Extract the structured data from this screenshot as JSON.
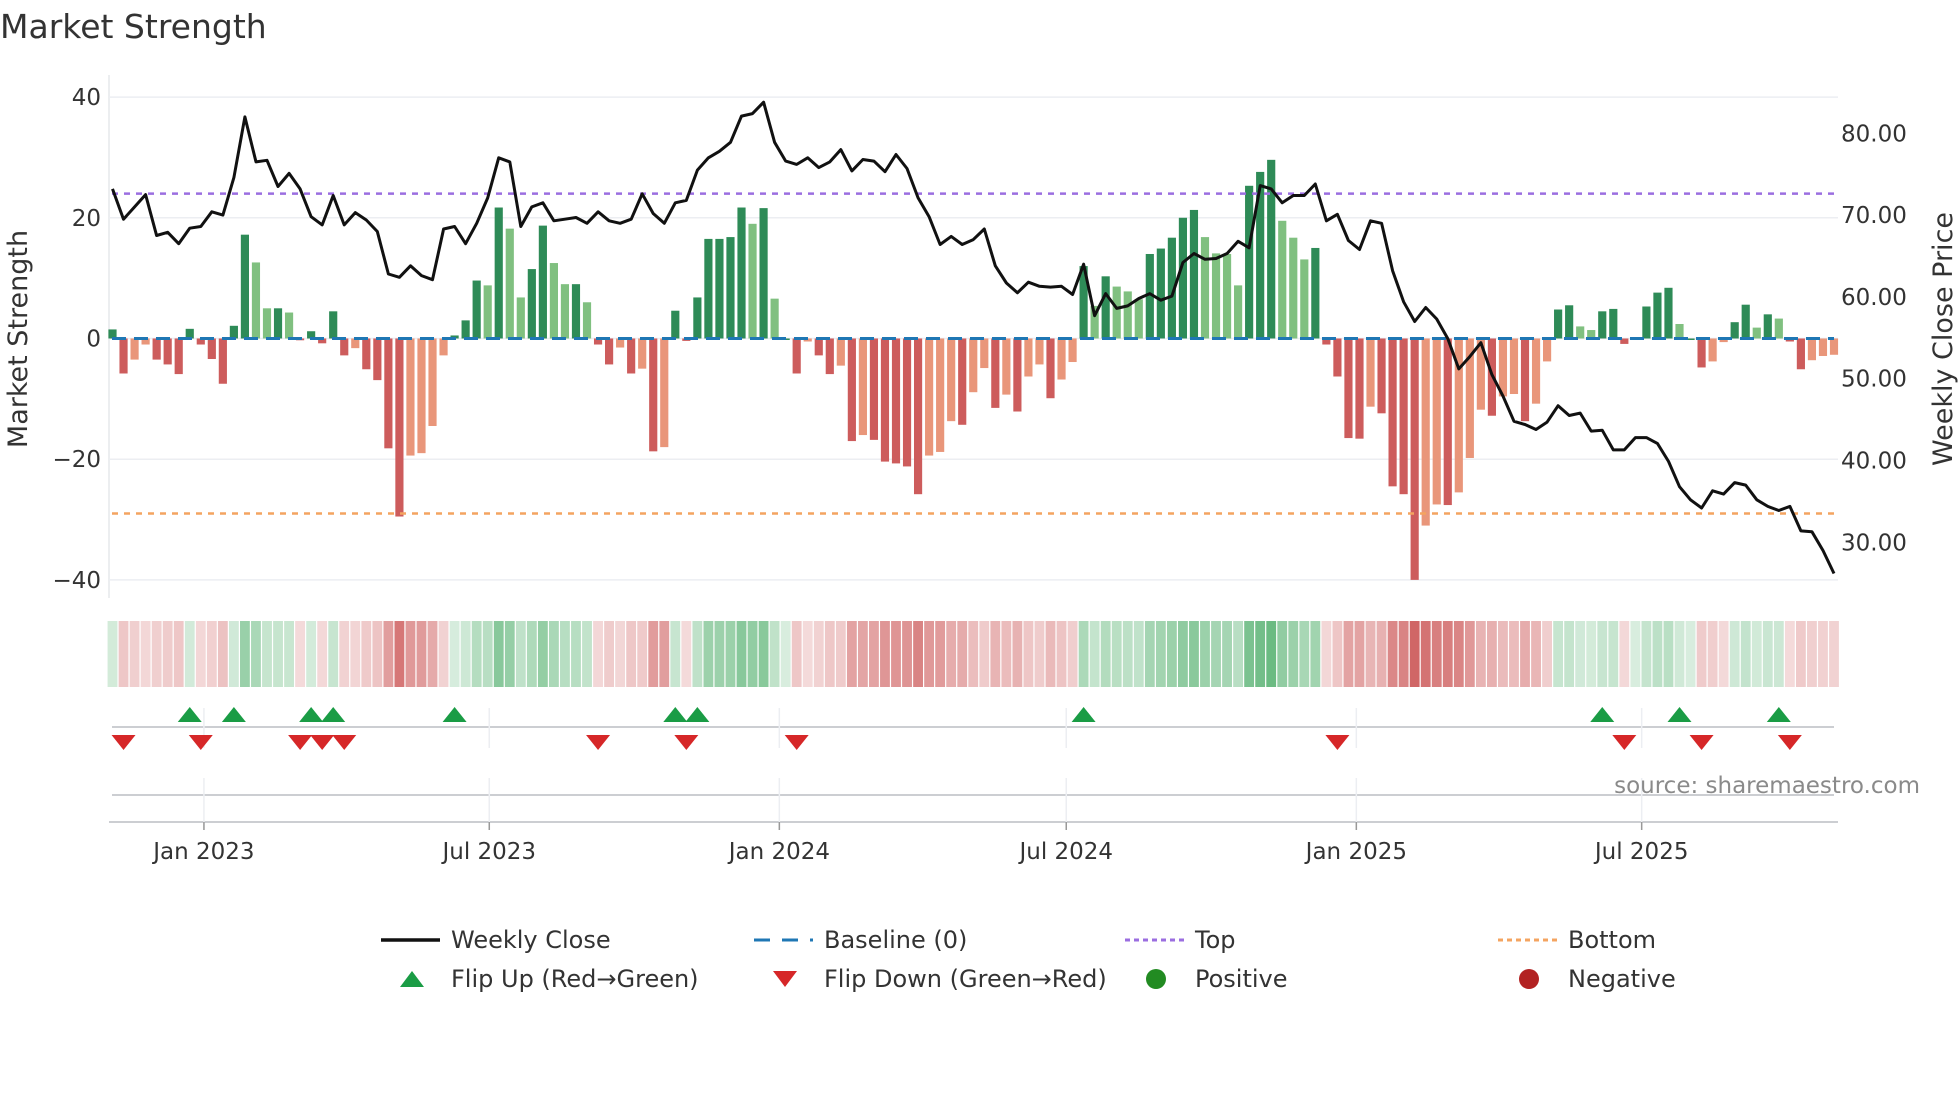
{
  "title": "Market Strength",
  "source": "source: sharemaestro.com",
  "chart_data": {
    "type": "bar+line",
    "left_axis": {
      "label": "Market Strength",
      "ylim": [
        -43,
        42
      ],
      "ticks": [
        -40,
        -20,
        0,
        20,
        40
      ],
      "tick_labels": [
        "−40",
        "−20",
        "0",
        "20",
        "40"
      ]
    },
    "right_axis": {
      "label": "Weekly Close Price",
      "ylim": [
        23.2,
        85.9
      ],
      "ticks": [
        30,
        40,
        50,
        60,
        70,
        80
      ],
      "tick_labels": [
        "30.00",
        "40.00",
        "50.00",
        "60.00",
        "70.00",
        "80.00"
      ]
    },
    "x_ticks": [
      {
        "date": "2023-01-01",
        "label": "Jan 2023"
      },
      {
        "date": "2023-07-01",
        "label": "Jul 2023"
      },
      {
        "date": "2024-01-01",
        "label": "Jan 2024"
      },
      {
        "date": "2024-07-01",
        "label": "Jul 2024"
      },
      {
        "date": "2025-01-01",
        "label": "Jan 2025"
      },
      {
        "date": "2025-07-01",
        "label": "Jul 2025"
      }
    ],
    "grid": true,
    "top_level": 24,
    "bottom_level": -29,
    "colors": {
      "close": "#111111",
      "baseline": "#1f77b4",
      "top": "#9b6ee0",
      "bottom": "#f4a460",
      "pos_strong": "#2e8b57",
      "pos_weak": "#80c080",
      "neg_strong": "#cd5c5c",
      "neg_weak": "#e9967a",
      "flip_up": "#1a9c45",
      "flip_down": "#d62728",
      "positive": "#228b22",
      "negative": "#b22222"
    },
    "dates": [
      "2022-11-04",
      "2022-11-11",
      "2022-11-18",
      "2022-11-25",
      "2022-12-02",
      "2022-12-09",
      "2022-12-16",
      "2022-12-23",
      "2022-12-30",
      "2023-01-06",
      "2023-01-13",
      "2023-01-20",
      "2023-01-27",
      "2023-02-03",
      "2023-02-10",
      "2023-02-17",
      "2023-02-24",
      "2023-03-03",
      "2023-03-10",
      "2023-03-17",
      "2023-03-24",
      "2023-03-31",
      "2023-04-07",
      "2023-04-14",
      "2023-04-21",
      "2023-04-28",
      "2023-05-05",
      "2023-05-12",
      "2023-05-19",
      "2023-05-26",
      "2023-06-02",
      "2023-06-09",
      "2023-06-16",
      "2023-06-23",
      "2023-06-30",
      "2023-07-07",
      "2023-07-14",
      "2023-07-21",
      "2023-07-28",
      "2023-08-04",
      "2023-08-11",
      "2023-08-18",
      "2023-08-25",
      "2023-09-01",
      "2023-09-08",
      "2023-09-15",
      "2023-09-22",
      "2023-09-29",
      "2023-10-06",
      "2023-10-13",
      "2023-10-20",
      "2023-10-27",
      "2023-11-03",
      "2023-11-10",
      "2023-11-17",
      "2023-11-24",
      "2023-12-01",
      "2023-12-08",
      "2023-12-15",
      "2023-12-22",
      "2023-12-29",
      "2024-01-05",
      "2024-01-12",
      "2024-01-19",
      "2024-01-26",
      "2024-02-02",
      "2024-02-09",
      "2024-02-16",
      "2024-02-23",
      "2024-03-01",
      "2024-03-08",
      "2024-03-15",
      "2024-03-22",
      "2024-03-29",
      "2024-04-05",
      "2024-04-12",
      "2024-04-19",
      "2024-04-26",
      "2024-05-03",
      "2024-05-10",
      "2024-05-17",
      "2024-05-24",
      "2024-05-31",
      "2024-06-07",
      "2024-06-14",
      "2024-06-21",
      "2024-06-28",
      "2024-07-05",
      "2024-07-12",
      "2024-07-19",
      "2024-07-26",
      "2024-08-02",
      "2024-08-09",
      "2024-08-16",
      "2024-08-23",
      "2024-08-30",
      "2024-09-06",
      "2024-09-13",
      "2024-09-20",
      "2024-09-27",
      "2024-10-04",
      "2024-10-11",
      "2024-10-18",
      "2024-10-25",
      "2024-11-01",
      "2024-11-08",
      "2024-11-15",
      "2024-11-22",
      "2024-11-29",
      "2024-12-06",
      "2024-12-13",
      "2024-12-20",
      "2024-12-27",
      "2025-01-03",
      "2025-01-10",
      "2025-01-17",
      "2025-01-24",
      "2025-01-31",
      "2025-02-07",
      "2025-02-14",
      "2025-02-21",
      "2025-02-28",
      "2025-03-07",
      "2025-03-14",
      "2025-03-21",
      "2025-03-28",
      "2025-04-04",
      "2025-04-11",
      "2025-04-18",
      "2025-04-25",
      "2025-05-02",
      "2025-05-09",
      "2025-05-16",
      "2025-05-23",
      "2025-05-30",
      "2025-06-06",
      "2025-06-13",
      "2025-06-20",
      "2025-06-27",
      "2025-07-04",
      "2025-07-11",
      "2025-07-18",
      "2025-07-25",
      "2025-08-01",
      "2025-08-08",
      "2025-08-15",
      "2025-08-22",
      "2025-08-29",
      "2025-09-05",
      "2025-09-12",
      "2025-09-19",
      "2025-09-26",
      "2025-10-03",
      "2025-10-10",
      "2025-10-17",
      "2025-10-24",
      "2025-10-31"
    ],
    "strength": [
      1.5,
      -5.8,
      -3.5,
      -1,
      -3.5,
      -4.3,
      -5.9,
      1.6,
      -1,
      -3.4,
      -7.5,
      2.1,
      17.2,
      12.6,
      5,
      5,
      4.3,
      -0.3,
      1.2,
      -0.8,
      4.5,
      -2.8,
      -1.6,
      -5.1,
      -6.9,
      -18.2,
      -29.5,
      -19.4,
      -19,
      -14.5,
      -2.8,
      0.5,
      3,
      9.6,
      8.8,
      21.7,
      18.2,
      6.8,
      11.5,
      18.7,
      12.5,
      9,
      9,
      6,
      -1,
      -4.3,
      -1.5,
      -5.8,
      -5,
      -18.7,
      -18,
      4.6,
      -0.4,
      6.8,
      16.5,
      16.5,
      16.8,
      21.7,
      19,
      21.6,
      6.6,
      0,
      -5.8,
      -0.5,
      -2.8,
      -5.9,
      -4.5,
      -17,
      -16,
      -16.8,
      -20.4,
      -20.7,
      -21.2,
      -25.8,
      -19.4,
      -18.8,
      -13.7,
      -14.3,
      -8.9,
      -4.9,
      -11.5,
      -9.3,
      -12.1,
      -6.3,
      -4.3,
      -9.9,
      -6.8,
      -3.9,
      12,
      5.4,
      10.3,
      8.6,
      7.8,
      6.5,
      14,
      14.9,
      16.7,
      20,
      21.3,
      16.8,
      14.1,
      14,
      8.8,
      25.3,
      27.6,
      29.6,
      19.5,
      16.7,
      13.1,
      15,
      -1,
      -6.3,
      -16.5,
      -16.6,
      -11.3,
      -12.4,
      -24.5,
      -25.8,
      -40,
      -31,
      -27.5,
      -27.6,
      -25.5,
      -19.8,
      -11.8,
      -12.8,
      -9.6,
      -9.2,
      -13.7,
      -10.8,
      -3.8,
      4.8,
      5.5,
      2,
      1.4,
      4.5,
      4.9,
      -0.9,
      0,
      5.3,
      7.6,
      8.4,
      2.4,
      0,
      -4.8,
      -3.8,
      -0.6,
      2.7,
      5.6,
      1.8,
      4,
      3.3,
      -0.5,
      -5.1,
      -3.6,
      -2.9,
      -2.7
    ],
    "weekly_close": [
      73.2,
      69.5,
      71.0,
      72.5,
      67.5,
      67.9,
      66.5,
      68.4,
      68.6,
      70.4,
      70.0,
      74.6,
      82.0,
      76.5,
      76.7,
      73.5,
      75.1,
      73.2,
      69.8,
      68.8,
      72.4,
      68.8,
      70.3,
      69.4,
      68.0,
      62.8,
      62.4,
      63.8,
      62.6,
      62.1,
      68.3,
      68.6,
      66.5,
      69.0,
      72.1,
      77.0,
      76.5,
      68.6,
      71.0,
      71.5,
      69.3,
      69.5,
      69.7,
      69.0,
      70.4,
      69.3,
      69.0,
      69.5,
      72.6,
      70.2,
      69.0,
      71.5,
      71.8,
      75.5,
      77.0,
      77.8,
      78.9,
      82.1,
      82.4,
      83.8,
      78.9,
      76.6,
      76.2,
      77.0,
      75.8,
      76.5,
      78.0,
      75.4,
      76.8,
      76.6,
      75.3,
      77.4,
      75.7,
      72.1,
      69.8,
      66.4,
      67.4,
      66.4,
      67.0,
      68.3,
      63.8,
      61.7,
      60.5,
      61.8,
      61.3,
      61.2,
      61.3,
      60.3,
      64.0,
      57.7,
      60.4,
      58.6,
      58.9,
      59.8,
      60.4,
      59.6,
      60.1,
      64.2,
      65.3,
      64.6,
      64.7,
      65.3,
      66.8,
      66.0,
      73.6,
      73.2,
      71.5,
      72.4,
      72.4,
      73.8,
      69.3,
      70.1,
      66.9,
      65.8,
      69.3,
      69.0,
      63.2,
      59.4,
      57.0,
      58.7,
      57.3,
      54.9,
      51.2,
      52.7,
      54.4,
      50.5,
      47.9,
      44.8,
      44.4,
      43.8,
      44.7,
      46.7,
      45.5,
      45.8,
      43.6,
      43.7,
      41.3,
      41.3,
      42.8,
      42.8,
      42.1,
      39.9,
      36.8,
      35.2,
      34.2,
      36.3,
      35.9,
      37.3,
      37.0,
      35.2,
      34.4,
      33.9,
      34.4,
      31.4,
      31.3,
      29.0,
      26.2
    ],
    "flip_up": [
      "2022-12-23",
      "2023-01-20",
      "2023-03-10",
      "2023-03-24",
      "2023-06-09",
      "2023-10-27",
      "2023-11-10",
      "2024-07-12",
      "2025-06-06",
      "2025-07-25",
      "2025-09-26"
    ],
    "flip_down": [
      "2022-11-11",
      "2022-12-30",
      "2023-03-03",
      "2023-03-17",
      "2023-03-31",
      "2023-09-08",
      "2023-11-03",
      "2024-01-12",
      "2024-12-20",
      "2025-06-20",
      "2025-08-08",
      "2025-10-03"
    ]
  },
  "legend": {
    "items": [
      {
        "label": "Weekly Close",
        "symbol": "line"
      },
      {
        "label": "Baseline (0)",
        "symbol": "dash"
      },
      {
        "label": "Top",
        "symbol": "dot-purple"
      },
      {
        "label": "Bottom",
        "symbol": "dot-orange"
      },
      {
        "label": "Flip Up (Red→Green)",
        "symbol": "triangle-up"
      },
      {
        "label": "Flip Down (Green→Red)",
        "symbol": "triangle-down"
      },
      {
        "label": "Positive",
        "symbol": "circle-green"
      },
      {
        "label": "Negative",
        "symbol": "circle-red"
      }
    ]
  }
}
